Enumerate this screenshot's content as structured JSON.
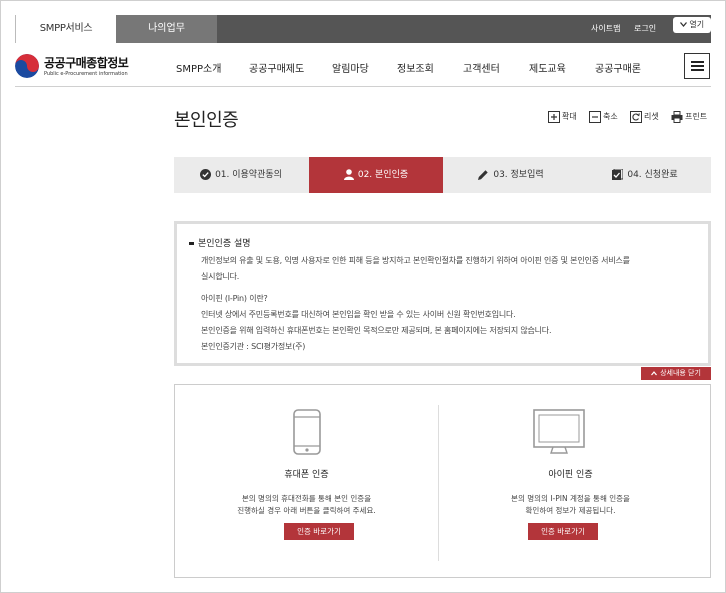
{
  "topbar": {
    "tab_smpp": "SMPP서비스",
    "tab_my": "나의업무",
    "sitemap": "사이트맵",
    "login": "로그인",
    "open": "열기"
  },
  "header": {
    "logo_title": "공공구매종합정보",
    "logo_sub": "Public e-Procurement information",
    "menu": [
      "SMPP소개",
      "공공구매제도",
      "알림마당",
      "정보조회",
      "고객센터",
      "제도교육",
      "공공구매론"
    ]
  },
  "page": {
    "title": "본인인증",
    "tools": {
      "zoom_in": "확대",
      "zoom_out": "축소",
      "reset": "리셋",
      "print": "프린트"
    }
  },
  "steps": [
    {
      "label": "01. 이용약관동의",
      "icon": "check-circle-icon"
    },
    {
      "label": "02. 본인인증",
      "icon": "person-icon",
      "active": true
    },
    {
      "label": "03. 정보입력",
      "icon": "pencil-icon"
    },
    {
      "label": "04. 신청완료",
      "icon": "document-check-icon"
    }
  ],
  "info": {
    "heading": "본인인증 설명",
    "para1_line1": "개인정보의 유출 및 도용, 익명 사용자로 인한 피해 등을 방지하고 본인확인절차를 진행하기 위하여 아이핀 인증 및 본인인증 서비스를",
    "para1_line2": "실시합니다.",
    "ipin_q": "아이핀 (I-Pin) 이란?",
    "ipin_a1": "인터넷 상에서 주민등록번호를 대신하여 본인임을 확인 받을 수 있는 사이버 신원 확인번호입니다.",
    "ipin_a2": "본인인증을 위해 입력하신 휴대폰번호는 본인확인 목적으로만 제공되며, 본 홈페이지에는 저장되지 않습니다.",
    "agency": "본인인증기관 : SCI평가정보(주)"
  },
  "close_detail": "상세내용 닫기",
  "auth": {
    "phone": {
      "title": "휴대폰 인증",
      "desc1": "본의 명의의 휴대전화를 통해 본인 인증을",
      "desc2": "진행하실 경우 아래 버튼을 클릭하여 주세요.",
      "button": "인증 바로가기"
    },
    "ipin": {
      "title": "아이핀 인증",
      "desc1": "본의 명의의 I-PIN 계정을 통해 인증을",
      "desc2": "확인하여 정보가 제공됩니다.",
      "button": "인증 바로가기"
    }
  },
  "colors": {
    "accent": "#b3353a",
    "topbar": "#555555",
    "step_bg": "#ebebeb"
  }
}
